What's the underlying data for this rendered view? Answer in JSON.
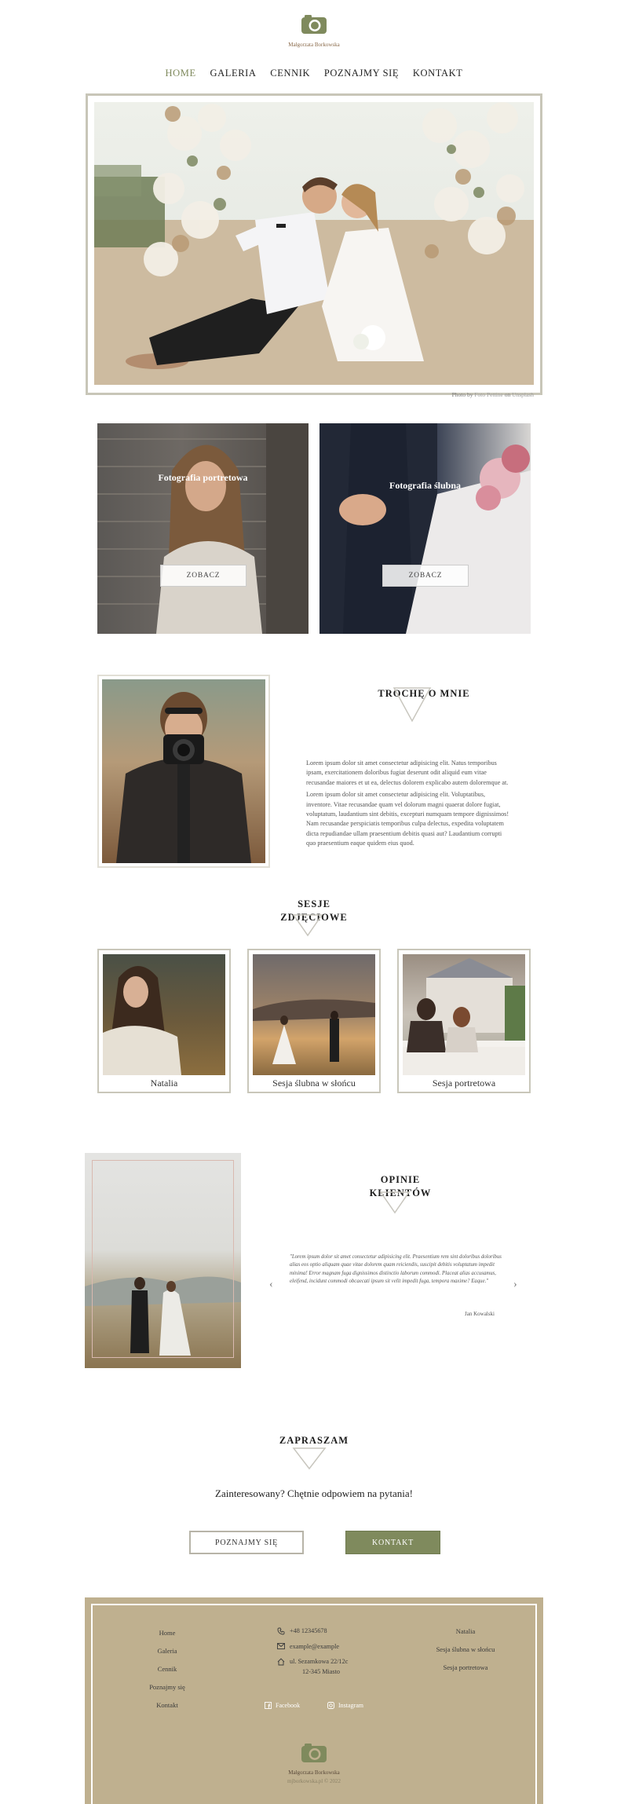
{
  "brand": {
    "name": "Małgorzata Borkowska",
    "accent": "#7f8a5d",
    "footer_bg": "#bfb08f"
  },
  "nav": {
    "items": [
      "HOME",
      "GALERIA",
      "CENNIK",
      "POZNAJMY SIĘ",
      "KONTAKT"
    ],
    "active": "HOME"
  },
  "hero": {
    "credit_prefix": "Photo by",
    "credit_author": "Foto Pettine",
    "credit_on": "on",
    "credit_site": "Unsplash"
  },
  "categories": [
    {
      "title": "Fotografia portretowa",
      "button": "ZOBACZ"
    },
    {
      "title": "Fotografia ślubna",
      "button": "ZOBACZ"
    }
  ],
  "about": {
    "title": "TROCHĘ O MNIE",
    "paragraphs": [
      "Lorem ipsum dolor sit amet consectetur adipisicing elit. Natus temporibus ipsam, exercitationem doloribus fugiat deserunt odit aliquid eum vitae recusandae maiores et ut ea, delectus dolorem explicabo autem doloremque at.",
      "Lorem ipsum dolor sit amet consectetur adipisicing elit. Voluptatibus, inventore. Vitae recusandae quam vel dolorum magni quaerat dolore fugiat, voluptatum, laudantium sint debitis, excepturi numquam tempore dignissimos! Nam recusandae perspiciatis temporibus culpa delectus, expedita voluptatem dicta repudiandae ullam praesentium debitis quasi aut? Laudantium corrupti quo praesentium eaque quidem eius quod."
    ]
  },
  "sessions": {
    "title": "SESJE ZDJĘCIOWE",
    "items": [
      {
        "label": "Natalia"
      },
      {
        "label": "Sesja ślubna w słońcu"
      },
      {
        "label": "Sesja portretowa"
      }
    ]
  },
  "testimonials": {
    "title": "OPINIE KLIENTÓW",
    "quote": "\"Lorem ipsum dolor sit amet consectetur adipisicing elit. Praesentium rem sint doloribus doloribus alias eos optio aliquam quae vitae dolorem quam reiciendis, suscipit debitis voluptatum impedit minima! Error magnam fuga dignissimos distinctio laborum commodi. Placeat alias accusamus, eleifend, incidunt commodi obcaecati ipsum sit velit impedit fuga, tempora maxime? Eaque.\"",
    "author": "Jan Kowalski",
    "prev": "‹",
    "next": "›"
  },
  "invite": {
    "title": "ZAPRASZAM",
    "text": "Zainteresowany? Chętnie odpowiem na pytania!",
    "btn_about": "POZNAJMY SIĘ",
    "btn_contact": "KONTAKT"
  },
  "footer": {
    "links_left": [
      "Home",
      "Galeria",
      "Cennik",
      "Poznajmy się",
      "Kontakt"
    ],
    "phone": "+48 12345678",
    "email": "example@example",
    "address_line1": "ul. Sezamkowa 22/12c",
    "address_line2": "12-345 Miasto",
    "facebook": "Facebook",
    "instagram": "Instagram",
    "links_right": [
      "Natalia",
      "Sesja ślubna w słońcu",
      "Sesja portretowa"
    ],
    "brand": "Małgorzata Borkowska",
    "copyright": "mjborkowska.pl © 2022"
  }
}
